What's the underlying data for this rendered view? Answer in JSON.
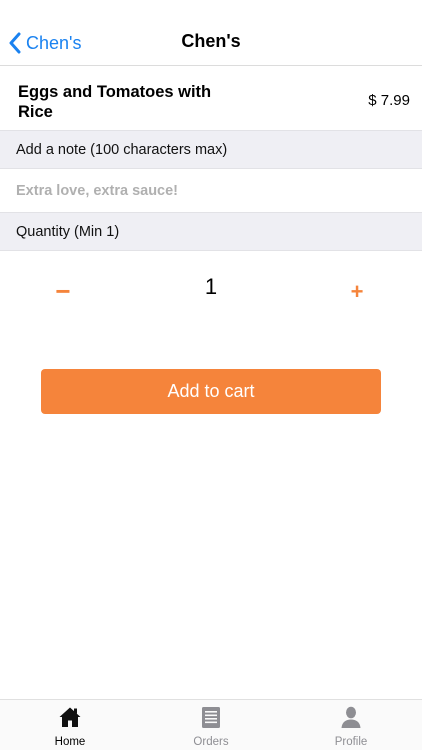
{
  "nav": {
    "back_label": "Chen's",
    "title": "Chen's"
  },
  "item": {
    "name": "Eggs and Tomatoes with Rice",
    "price": "$ 7.99"
  },
  "note": {
    "header": "Add a note (100 characters max)",
    "placeholder": "Extra love, extra sauce!"
  },
  "quantity": {
    "header": "Quantity (Min 1)",
    "value": "1",
    "minus_label": "−",
    "plus_label": "+"
  },
  "cart": {
    "button_label": "Add to cart"
  },
  "tabs": [
    {
      "label": "Home",
      "icon": "home-icon",
      "active": true
    },
    {
      "label": "Orders",
      "icon": "orders-icon",
      "active": false
    },
    {
      "label": "Profile",
      "icon": "profile-icon",
      "active": false
    }
  ],
  "colors": {
    "accent": "#f5843b",
    "link": "#1a82f0",
    "section_bg": "#efeff4",
    "inactive_tab": "#8e8e93"
  }
}
